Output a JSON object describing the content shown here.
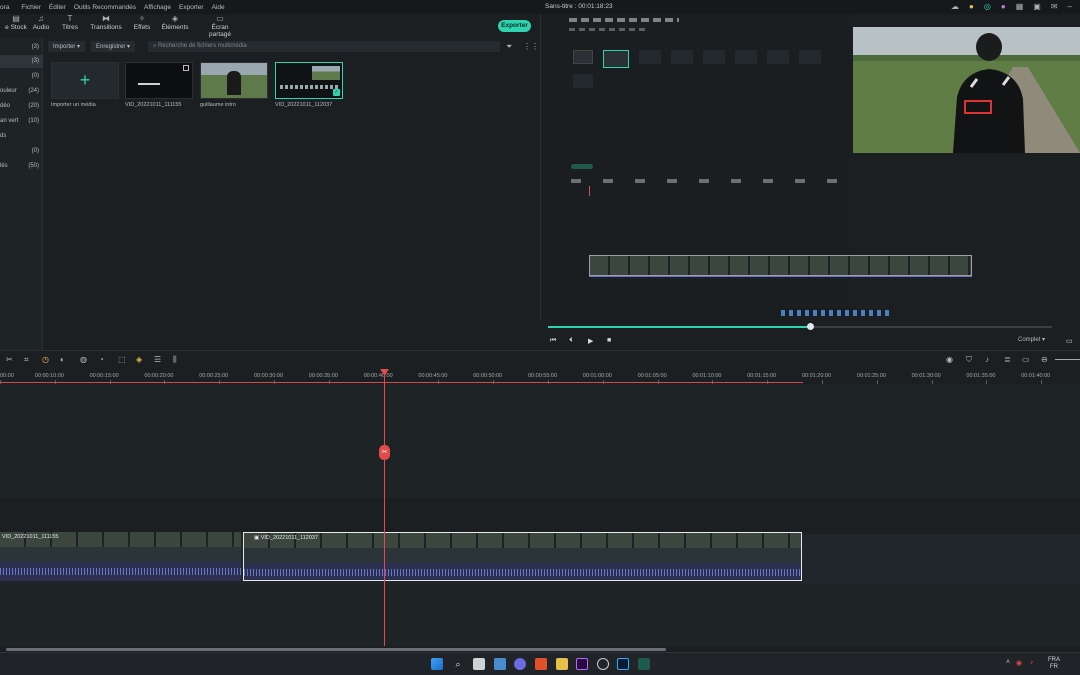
{
  "menu": {
    "app_label": "ora",
    "items": [
      "Fichier",
      "Éditer",
      "Outils Recommandés",
      "Affichage",
      "Exporter",
      "Aide"
    ]
  },
  "project_title": "Sans-titre : 00:01:18:23",
  "tool_tabs": [
    {
      "label": "e Stock",
      "icon": "folder-icon"
    },
    {
      "label": "Audio",
      "icon": "music-icon"
    },
    {
      "label": "Titres",
      "icon": "text-icon"
    },
    {
      "label": "Transitions",
      "icon": "transition-icon"
    },
    {
      "label": "Effets",
      "icon": "effects-icon"
    },
    {
      "label": "Éléments",
      "icon": "elements-icon"
    },
    {
      "label": "Écran partagé",
      "icon": "split-screen-icon"
    }
  ],
  "export_label": "Exporter",
  "categories": [
    {
      "label": "",
      "count": "(3)"
    },
    {
      "label": "",
      "count": "(3)"
    },
    {
      "label": "",
      "count": "(0)"
    },
    {
      "label": "ouleur",
      "count": "(24)"
    },
    {
      "label": "déo",
      "count": "(20)"
    },
    {
      "label": "an vert",
      "count": "(10)"
    },
    {
      "label": "ds",
      "count": ""
    },
    {
      "label": "",
      "count": "(0)"
    },
    {
      "label": "lés",
      "count": "(50)"
    }
  ],
  "media_toolbar": {
    "import": "Importer",
    "record": "Enregistrer",
    "search_placeholder": "Recherche de fichiers multimédia"
  },
  "media_items": [
    {
      "name": "Importer un média"
    },
    {
      "name": "VID_20221011_111155"
    },
    {
      "name": "guillaume intro"
    },
    {
      "name": "VID_20221011_112037"
    }
  ],
  "player": {
    "progress": 0.52,
    "quality": "Complet"
  },
  "ruler_ticks": [
    "00:00",
    "00:00:10:00",
    "00:00:15:00",
    "00:00:20:00",
    "00:00:25:00",
    "00:00:30:00",
    "00:00:35:00",
    "00:00:40:00",
    "00:00:45:00",
    "00:00:50:00",
    "00:00:55:00",
    "00:01:00:00",
    "00:01:05:00",
    "00:01:10:00",
    "00:01:15:00",
    "00:01:20:00",
    "00:01:25:00",
    "00:01:30:00",
    "00:01:35:00",
    "00:01:40:00"
  ],
  "clips": [
    {
      "label": "VID_20221011_111155"
    },
    {
      "label": "VID_20221011_112037"
    }
  ],
  "clock": {
    "line1": "FRA",
    "line2": "FR"
  },
  "colors": {
    "accent": "#2fd3b0",
    "playhead": "#e24a4a",
    "audio": "#6a75c9"
  }
}
